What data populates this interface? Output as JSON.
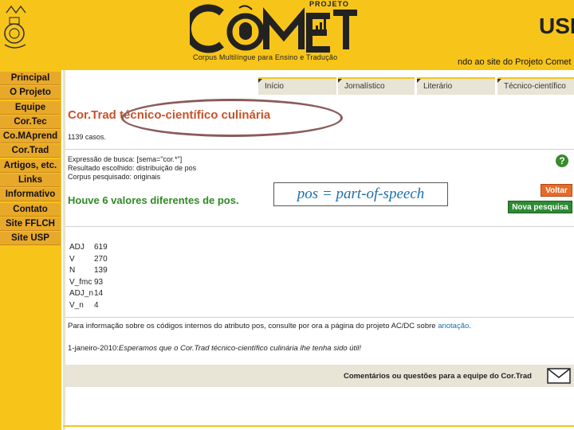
{
  "header": {
    "brand_title": "PROJETO",
    "brand_logo": "COMET",
    "brand_subtitle": "Corpus Multilíngue para Ensino e Tradução",
    "usp_logo": "USP",
    "welcome": "ndo ao site do Projeto Comet"
  },
  "sidebar": {
    "items": [
      {
        "label": "Principal"
      },
      {
        "label": "O Projeto"
      },
      {
        "label": "Equipe"
      },
      {
        "label": "Cor.Tec"
      },
      {
        "label": "Co.MAprend"
      },
      {
        "label": "Cor.Trad"
      },
      {
        "label": "Artigos, etc."
      },
      {
        "label": "Links"
      },
      {
        "label": "Informativo"
      },
      {
        "label": "Contato"
      },
      {
        "label": "Site FFLCH"
      },
      {
        "label": "Site USP"
      }
    ]
  },
  "tabs": [
    {
      "label": "Início"
    },
    {
      "label": "Jornalístico"
    },
    {
      "label": "Literário"
    },
    {
      "label": "Técnico-científico"
    }
  ],
  "main": {
    "title": "Cor.Trad técnico-científico culinária",
    "count": "1139 casos.",
    "query_line": "Expressão de busca: [sema=\"cor.*\"]",
    "result_line": "Resultado escolhido: distribuição de pos",
    "corpus_line": "Corpus pesquisado: originais",
    "result_heading": "Houve 6 valores diferentes de pos.",
    "annotation": "pos = part-of-speech",
    "back_button": "Voltar",
    "new_search_button": "Nova pesquisa",
    "help_icon": "?",
    "table": [
      {
        "label": "ADJ",
        "value": "619"
      },
      {
        "label": "V",
        "value": "270"
      },
      {
        "label": "N",
        "value": "139"
      },
      {
        "label": "V_fmc",
        "value": "93"
      },
      {
        "label": "ADJ_n",
        "value": "14"
      },
      {
        "label": "V_n",
        "value": "4"
      }
    ],
    "note_text": "Para informação sobre os códigos internos do atributo pos, consulte por ora a página do projeto AC/DC sobre ",
    "note_link": "anotação",
    "note_end": ".",
    "date_prefix": "1-janeiro-2010:",
    "date_text": "Esperamos que o Cor.Trad técnico-científico culinária lhe tenha sido útil!"
  },
  "footer": {
    "text": "Comentários ou questões para a equipe do Cor.Trad"
  },
  "colors": {
    "accent": "#f7c51a",
    "title": "#c8532a",
    "heading_green": "#2f8a26",
    "annotation": "#1b6faa"
  }
}
